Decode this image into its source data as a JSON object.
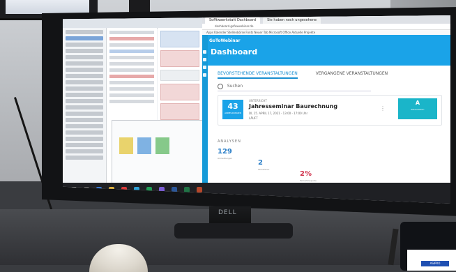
{
  "browser": {
    "tabs": [
      "Sofftwaerkstatt Dashboard",
      "Sie haben noch ungesehene"
    ],
    "address": "dashboard.gofoxwebinar.de",
    "bookmarks": "Apps  Kalender  Stellenbörse  Fonts  Neuer Tab  Microsoft Office  Aktuelle Projekte"
  },
  "dashboard": {
    "brand": "GoToWebinar",
    "title": "Dashboard",
    "tab_upcoming": "BEVORSTEHENDE VERANSTALTUNGEN",
    "tab_past": "VERGANGENE VERANSTALTUNGEN",
    "search_placeholder": "Suchen",
    "event": {
      "cal_day": "43",
      "cal_sub": "ANMELDUNGEN",
      "tag": "UNTERRICHT",
      "title": "Jahresseminar Baurechnung",
      "meta": "DI, 15. APRIL 17, 2021  ·  13:00 - 17:00 Uhr",
      "status": "LÄUFT",
      "more": "⋮",
      "badge_big": "A",
      "badge_sub": "Präsentation"
    },
    "analytics_label": "ANALYSEN",
    "stats": [
      {
        "value": "129",
        "label": "Anmeldungen"
      },
      {
        "value": "2",
        "label": "Teilnehmer"
      },
      {
        "value": "2%",
        "label": "Teilnahmequote"
      }
    ]
  },
  "monitor_brand": "DELL",
  "laptop_badge": "ASIPRO"
}
